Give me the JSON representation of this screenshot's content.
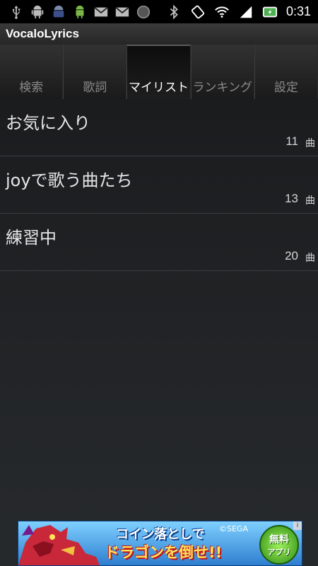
{
  "status_bar": {
    "badge_text": "95",
    "time": "0:31",
    "left_icons": [
      "usb-icon",
      "android-icon",
      "notification-95-icon",
      "android-green-icon",
      "gmail-icon",
      "gmail-icon",
      "circle-icon"
    ],
    "right_icons": [
      "bluetooth-icon",
      "rotate-icon",
      "wifi-icon",
      "signal-icon",
      "battery-charging-icon"
    ]
  },
  "app": {
    "title": "VocaloLyrics"
  },
  "tabs": [
    {
      "label": "検索",
      "active": false
    },
    {
      "label": "歌詞",
      "active": false
    },
    {
      "label": "マイリスト",
      "active": true
    },
    {
      "label": "ランキング",
      "active": false
    },
    {
      "label": "設定",
      "active": false
    }
  ],
  "mylists": [
    {
      "name": "お気に入り",
      "count": "11",
      "unit": "曲"
    },
    {
      "name": "joyで歌う曲たち",
      "count": "13",
      "unit": "曲"
    },
    {
      "name": "練習中",
      "count": "20",
      "unit": "曲"
    }
  ],
  "ad": {
    "line1": "コイン落としで",
    "line2": "ドラゴンを倒せ!!",
    "copyright": "©SEGA",
    "badge_top": "無料",
    "badge_bottom": "アプリ",
    "info": "i"
  },
  "colors": {
    "background": "#26292c",
    "tab_active_text": "#ffffff",
    "tab_inactive_text": "#8a8a8a",
    "ad_badge": "#2f8a14"
  }
}
